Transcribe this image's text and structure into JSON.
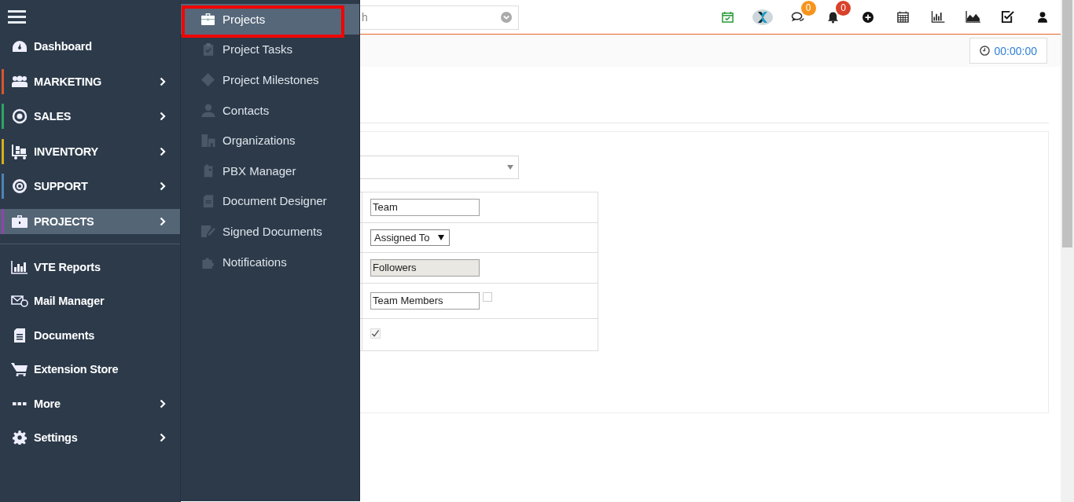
{
  "sidebar": {
    "items": [
      {
        "label": "Dashboard",
        "submenu": false,
        "selected": false
      },
      {
        "label": "MARKETING",
        "submenu": true,
        "selected": false,
        "color": "#d9572b"
      },
      {
        "label": "SALES",
        "submenu": true,
        "selected": false,
        "color": "#2ea565"
      },
      {
        "label": "INVENTORY",
        "submenu": true,
        "selected": false,
        "color": "#d6b019"
      },
      {
        "label": "SUPPORT",
        "submenu": true,
        "selected": false,
        "color": "#4f84b5"
      },
      {
        "label": "PROJECTS",
        "submenu": true,
        "selected": true,
        "color": "#8e44ad"
      }
    ],
    "bottom_items": [
      {
        "label": "VTE Reports",
        "submenu": false
      },
      {
        "label": "Mail Manager",
        "submenu": false
      },
      {
        "label": "Documents",
        "submenu": false
      },
      {
        "label": "Extension Store",
        "submenu": false
      },
      {
        "label": "More",
        "submenu": true
      },
      {
        "label": "Settings",
        "submenu": true
      }
    ]
  },
  "submenu": {
    "items": [
      {
        "label": "Projects",
        "selected": true,
        "highlighted": true
      },
      {
        "label": "Project Tasks",
        "selected": false,
        "highlighted": false
      },
      {
        "label": "Project Milestones",
        "selected": false,
        "highlighted": false
      },
      {
        "label": "Contacts",
        "selected": false,
        "highlighted": false
      },
      {
        "label": "Organizations",
        "selected": false,
        "highlighted": false
      },
      {
        "label": "PBX Manager",
        "selected": false,
        "highlighted": false
      },
      {
        "label": "Document Designer",
        "selected": false,
        "highlighted": false
      },
      {
        "label": "Signed Documents",
        "selected": false,
        "highlighted": false
      },
      {
        "label": "Notifications",
        "selected": false,
        "highlighted": false
      }
    ]
  },
  "top_bar": {
    "search": {
      "placeholder": "h"
    },
    "badges": [
      {
        "badge": "0",
        "color": "#f7941d"
      },
      {
        "badge": "0",
        "color": "#d9412b"
      }
    ]
  },
  "timer": {
    "label": "00:00:00"
  },
  "form": {
    "rows": [
      {
        "kind": "text",
        "value": "Team",
        "disabled": false
      },
      {
        "kind": "select",
        "value": "Assigned To"
      },
      {
        "kind": "text",
        "value": "Followers",
        "disabled": true
      },
      {
        "kind": "text",
        "value": "Team Members",
        "disabled": false,
        "checked": false
      },
      {
        "kind": "checkbox",
        "checked": true
      }
    ]
  }
}
